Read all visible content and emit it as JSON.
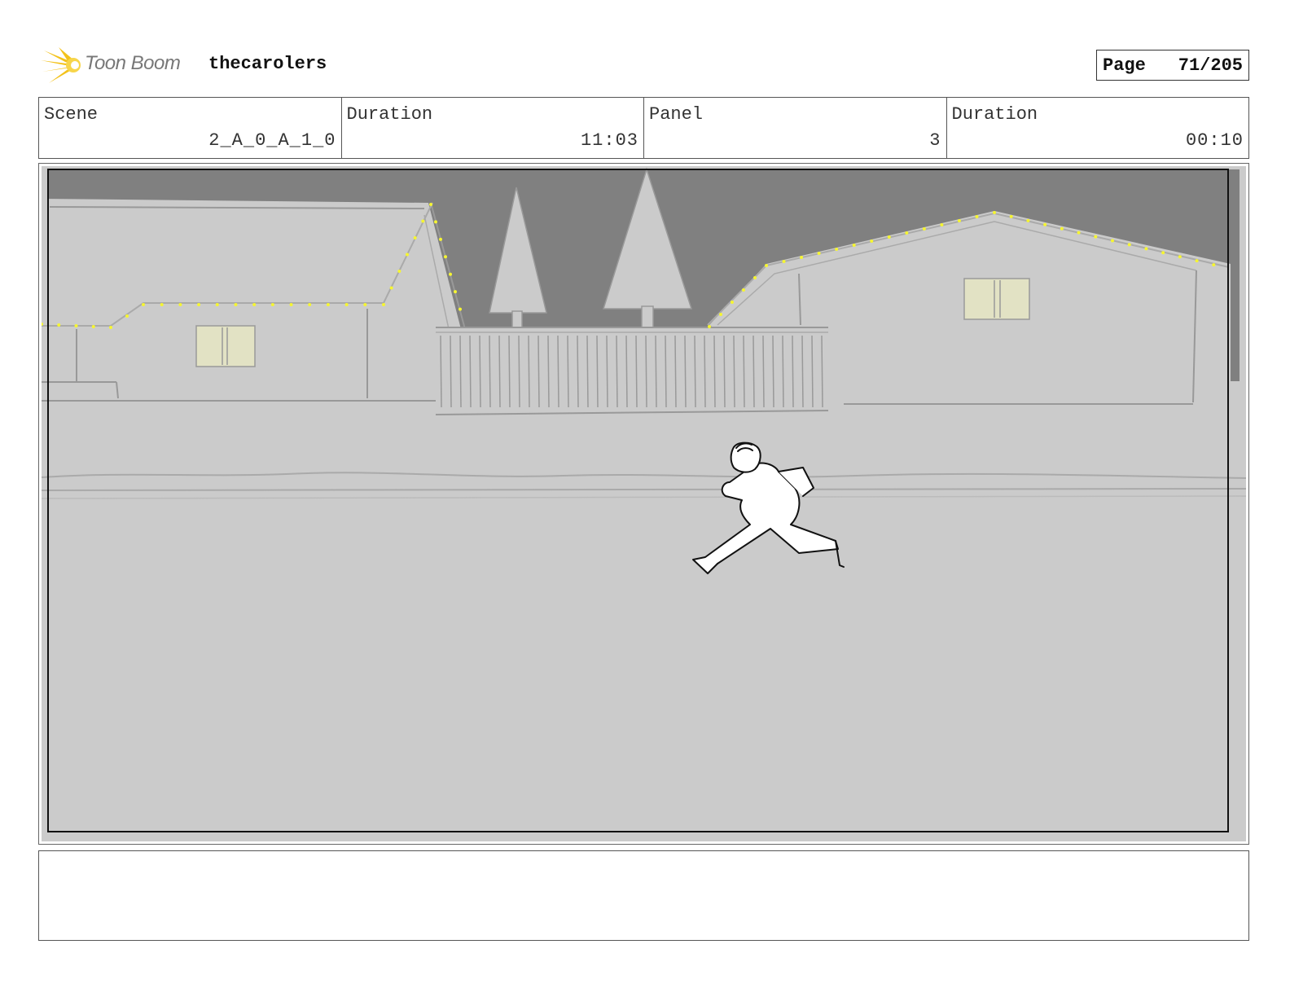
{
  "header": {
    "logo_text": "Toon Boom",
    "project_title": "thecarolers",
    "page_label": "Page",
    "page_number": "71/205"
  },
  "info": {
    "scene_label": "Scene",
    "scene_value": "2_A_0_A_1_0",
    "duration_label": "Duration",
    "duration_value": "11:03",
    "panel_label": "Panel",
    "panel_value": "3",
    "panel_duration_label": "Duration",
    "panel_duration_value": "00:10"
  },
  "panel_image": {
    "description_icons": [
      "house-left",
      "house-right",
      "pine-tree",
      "fence",
      "running-character",
      "string-lights"
    ],
    "colors": {
      "sky": "#7f7f7f",
      "ground": "#cbcbcb",
      "window": "#e2e2c4",
      "lights": "#f5f532"
    }
  },
  "notes": {
    "text": ""
  }
}
